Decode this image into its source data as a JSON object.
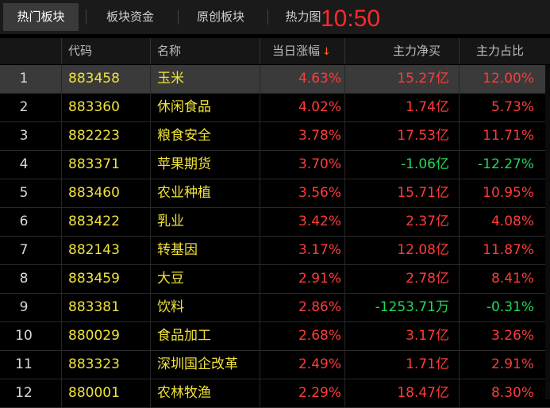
{
  "tabs": [
    {
      "label": "热门板块",
      "active": true
    },
    {
      "label": "板块资金",
      "active": false
    },
    {
      "label": "原创板块",
      "active": false
    },
    {
      "label": "热力图",
      "active": false
    }
  ],
  "clock": "10:50",
  "columns": {
    "code": "代码",
    "name": "名称",
    "change": "当日涨幅",
    "change_sort": "↓",
    "net_buy": "主力净买",
    "ratio": "主力占比"
  },
  "rows": [
    {
      "idx": "1",
      "code": "883458",
      "name": "玉米",
      "change": "4.63%",
      "net": "15.27亿",
      "ratio": "12.00%",
      "net_dir": "up",
      "ratio_dir": "up",
      "selected": true
    },
    {
      "idx": "2",
      "code": "883360",
      "name": "休闲食品",
      "change": "4.02%",
      "net": "1.74亿",
      "ratio": "5.73%",
      "net_dir": "up",
      "ratio_dir": "up"
    },
    {
      "idx": "3",
      "code": "882223",
      "name": "粮食安全",
      "change": "3.78%",
      "net": "17.53亿",
      "ratio": "11.71%",
      "net_dir": "up",
      "ratio_dir": "up"
    },
    {
      "idx": "4",
      "code": "883371",
      "name": "苹果期货",
      "change": "3.70%",
      "net": "-1.06亿",
      "ratio": "-12.27%",
      "net_dir": "down",
      "ratio_dir": "down"
    },
    {
      "idx": "5",
      "code": "883460",
      "name": "农业种植",
      "change": "3.56%",
      "net": "15.71亿",
      "ratio": "10.95%",
      "net_dir": "up",
      "ratio_dir": "up"
    },
    {
      "idx": "6",
      "code": "883422",
      "name": "乳业",
      "change": "3.42%",
      "net": "2.37亿",
      "ratio": "4.08%",
      "net_dir": "up",
      "ratio_dir": "up"
    },
    {
      "idx": "7",
      "code": "882143",
      "name": "转基因",
      "change": "3.17%",
      "net": "12.08亿",
      "ratio": "11.87%",
      "net_dir": "up",
      "ratio_dir": "up"
    },
    {
      "idx": "8",
      "code": "883459",
      "name": "大豆",
      "change": "2.91%",
      "net": "2.78亿",
      "ratio": "8.41%",
      "net_dir": "up",
      "ratio_dir": "up"
    },
    {
      "idx": "9",
      "code": "883381",
      "name": "饮料",
      "change": "2.86%",
      "net": "-1253.71万",
      "ratio": "-0.31%",
      "net_dir": "down",
      "ratio_dir": "down"
    },
    {
      "idx": "10",
      "code": "880029",
      "name": "食品加工",
      "change": "2.68%",
      "net": "3.17亿",
      "ratio": "3.26%",
      "net_dir": "up",
      "ratio_dir": "up"
    },
    {
      "idx": "11",
      "code": "883323",
      "name": "深圳国企改革",
      "change": "2.49%",
      "net": "1.71亿",
      "ratio": "2.91%",
      "net_dir": "up",
      "ratio_dir": "up"
    },
    {
      "idx": "12",
      "code": "880001",
      "name": "农林牧渔",
      "change": "2.29%",
      "net": "18.47亿",
      "ratio": "8.30%",
      "net_dir": "up",
      "ratio_dir": "up"
    }
  ],
  "colors": {
    "up": "#ff3b3b",
    "down": "#22d85a",
    "code": "#f0e23a",
    "clock": "#ff2a2a"
  }
}
